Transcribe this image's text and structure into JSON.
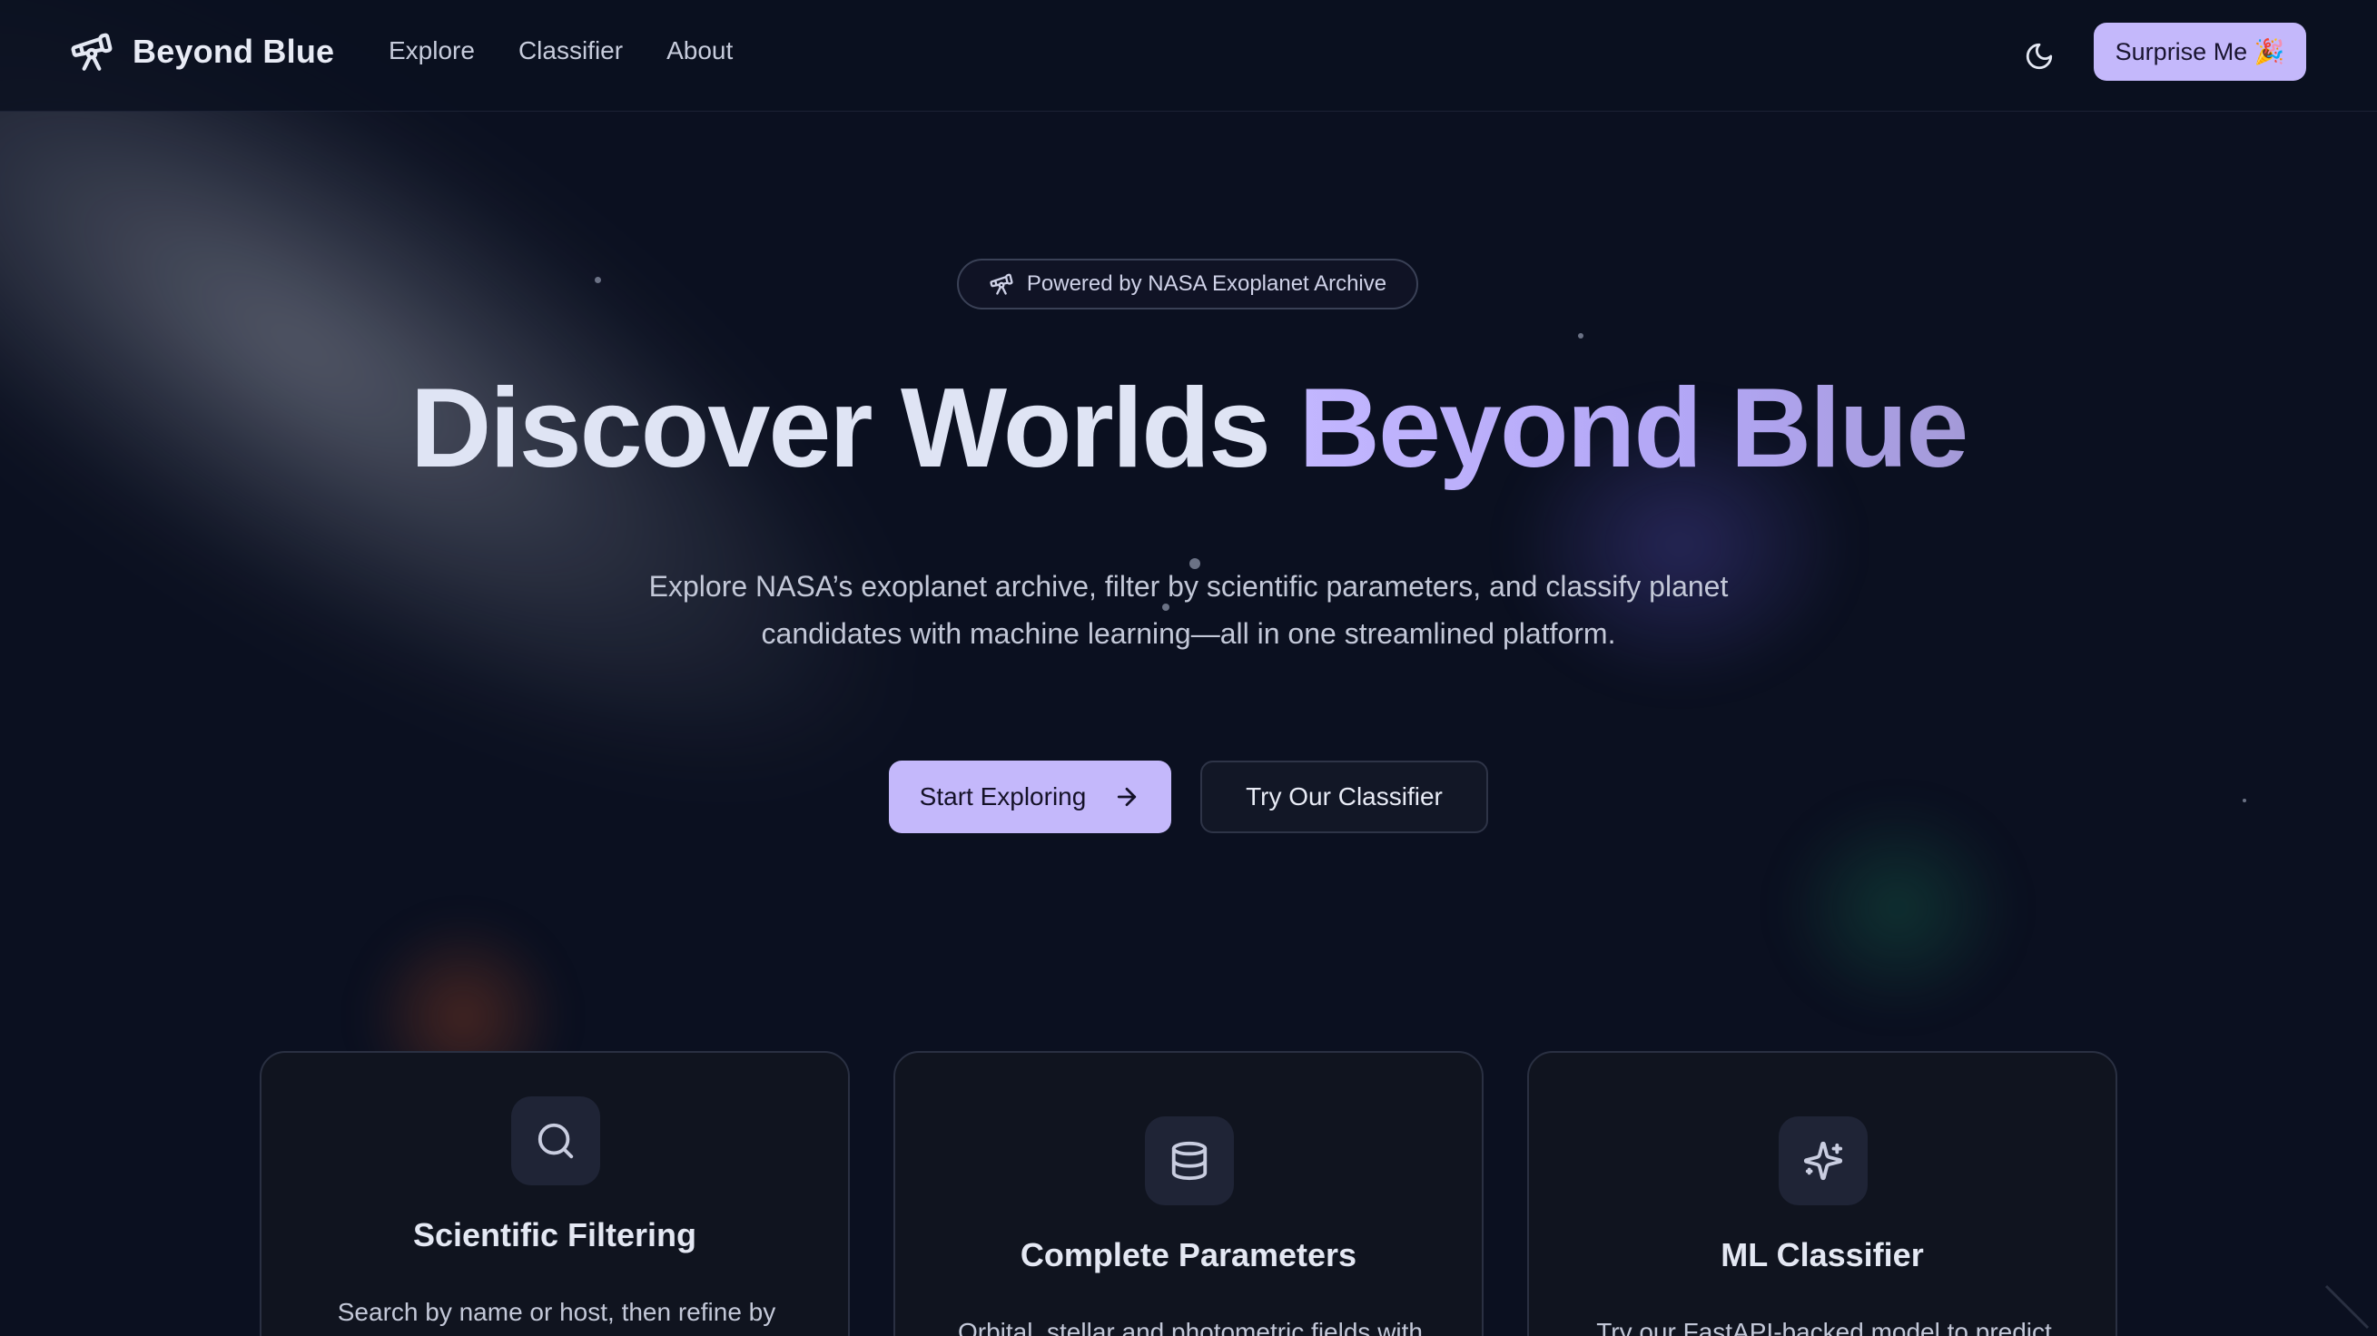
{
  "navbar": {
    "brand": "Beyond Blue",
    "links": [
      "Explore",
      "Classifier",
      "About"
    ],
    "surprise_label": "Surprise Me 🎉",
    "theme_icon": "moon-icon"
  },
  "hero": {
    "badge_text": "Powered by NASA Exoplanet Archive",
    "title_part1": "Discover Worlds ",
    "title_part2": "Beyond Blue",
    "description": "Explore NASA’s exoplanet archive, filter by scientific parameters, and classify planet candidates with machine learning—all in one streamlined platform.",
    "primary_cta": "Start Exploring",
    "secondary_cta": "Try Our Classifier"
  },
  "features": [
    {
      "icon": "search-icon",
      "title": "Scientific Filtering",
      "description": "Search by name or host, then refine by"
    },
    {
      "icon": "database-icon",
      "title": "Complete Parameters",
      "description": "Orbital, stellar and photometric fields with"
    },
    {
      "icon": "sparkles-icon",
      "title": "ML Classifier",
      "description": "Try our FastAPI-backed model to predict"
    }
  ],
  "colors": {
    "background": "#0b1020",
    "accent": "#c4b8fb",
    "title_light": "#dfe4f4",
    "card_border": "#2a3042"
  }
}
